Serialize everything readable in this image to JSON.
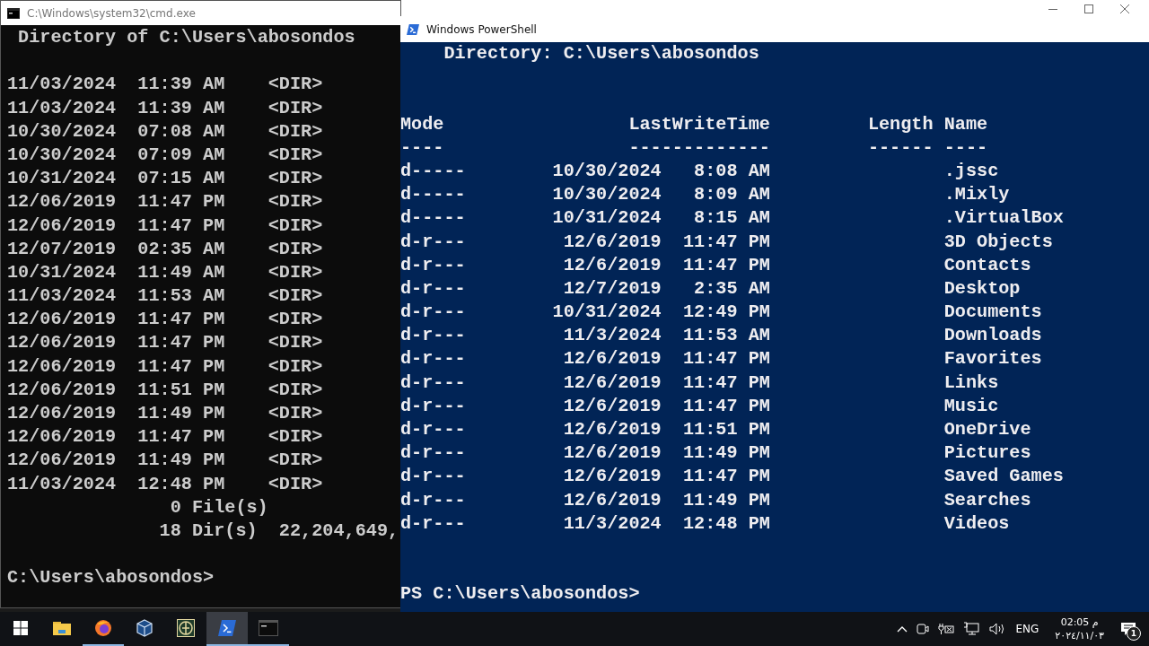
{
  "cmd_window": {
    "title": "C:\\Windows\\system32\\cmd.exe",
    "directory_line": "Directory of C:\\Users\\abosondos",
    "entries": [
      "11/03/2024  11:39 AM    <DIR>",
      "11/03/2024  11:39 AM    <DIR>",
      "10/30/2024  07:08 AM    <DIR>",
      "10/30/2024  07:09 AM    <DIR>",
      "10/31/2024  07:15 AM    <DIR>",
      "12/06/2019  11:47 PM    <DIR>",
      "12/06/2019  11:47 PM    <DIR>",
      "12/07/2019  02:35 AM    <DIR>",
      "10/31/2024  11:49 AM    <DIR>",
      "11/03/2024  11:53 AM    <DIR>",
      "12/06/2019  11:47 PM    <DIR>",
      "12/06/2019  11:47 PM    <DIR>",
      "12/06/2019  11:47 PM    <DIR>",
      "12/06/2019  11:51 PM    <DIR>",
      "12/06/2019  11:49 PM    <DIR>",
      "12/06/2019  11:47 PM    <DIR>",
      "12/06/2019  11:49 PM    <DIR>",
      "11/03/2024  12:48 PM    <DIR>"
    ],
    "summary": [
      "0 File(s)",
      "18 Dir(s)  22,204,649,"
    ],
    "prompt": "C:\\Users\\abosondos>"
  },
  "powershell_window": {
    "title": "Windows PowerShell",
    "directory_line": "Directory: C:\\Users\\abosondos",
    "columns": [
      {
        "label": "Mode",
        "underline": "----"
      },
      {
        "label": "LastWriteTime",
        "underline": "-------------"
      },
      {
        "label": "Length",
        "underline": "------"
      },
      {
        "label": "Name",
        "underline": "----"
      }
    ],
    "rows": [
      {
        "mode": "d-----",
        "date": "10/30/2024",
        "time": "8:08 AM",
        "name": ".jssc"
      },
      {
        "mode": "d-----",
        "date": "10/30/2024",
        "time": "8:09 AM",
        "name": ".Mixly"
      },
      {
        "mode": "d-----",
        "date": "10/31/2024",
        "time": "8:15 AM",
        "name": ".VirtualBox"
      },
      {
        "mode": "d-r---",
        "date": "12/6/2019",
        "time": "11:47 PM",
        "name": "3D Objects"
      },
      {
        "mode": "d-r---",
        "date": "12/6/2019",
        "time": "11:47 PM",
        "name": "Contacts"
      },
      {
        "mode": "d-r---",
        "date": "12/7/2019",
        "time": "2:35 AM",
        "name": "Desktop"
      },
      {
        "mode": "d-r---",
        "date": "10/31/2024",
        "time": "12:49 PM",
        "name": "Documents"
      },
      {
        "mode": "d-r---",
        "date": "11/3/2024",
        "time": "11:53 AM",
        "name": "Downloads"
      },
      {
        "mode": "d-r---",
        "date": "12/6/2019",
        "time": "11:47 PM",
        "name": "Favorites"
      },
      {
        "mode": "d-r---",
        "date": "12/6/2019",
        "time": "11:47 PM",
        "name": "Links"
      },
      {
        "mode": "d-r---",
        "date": "12/6/2019",
        "time": "11:47 PM",
        "name": "Music"
      },
      {
        "mode": "d-r---",
        "date": "12/6/2019",
        "time": "11:51 PM",
        "name": "OneDrive"
      },
      {
        "mode": "d-r---",
        "date": "12/6/2019",
        "time": "11:49 PM",
        "name": "Pictures"
      },
      {
        "mode": "d-r---",
        "date": "12/6/2019",
        "time": "11:47 PM",
        "name": "Saved Games"
      },
      {
        "mode": "d-r---",
        "date": "12/6/2019",
        "time": "11:49 PM",
        "name": "Searches"
      },
      {
        "mode": "d-r---",
        "date": "11/3/2024",
        "time": "12:48 PM",
        "name": "Videos"
      }
    ],
    "prompt": "PS C:\\Users\\abosondos>"
  },
  "taskbar": {
    "apps": [
      {
        "kind": "start",
        "running": false,
        "selected": false
      },
      {
        "kind": "folder",
        "running": false,
        "selected": false
      },
      {
        "kind": "browser",
        "running": true,
        "selected": false
      },
      {
        "kind": "cube",
        "running": false,
        "selected": false
      },
      {
        "kind": "emblem",
        "running": false,
        "selected": false
      },
      {
        "kind": "powershell",
        "running": true,
        "selected": true
      },
      {
        "kind": "console",
        "running": true,
        "selected": false
      }
    ],
    "language": "ENG",
    "time": "02:05 م",
    "date": "٢٠٢٤/١١/٠٣",
    "notification_count": "1"
  }
}
